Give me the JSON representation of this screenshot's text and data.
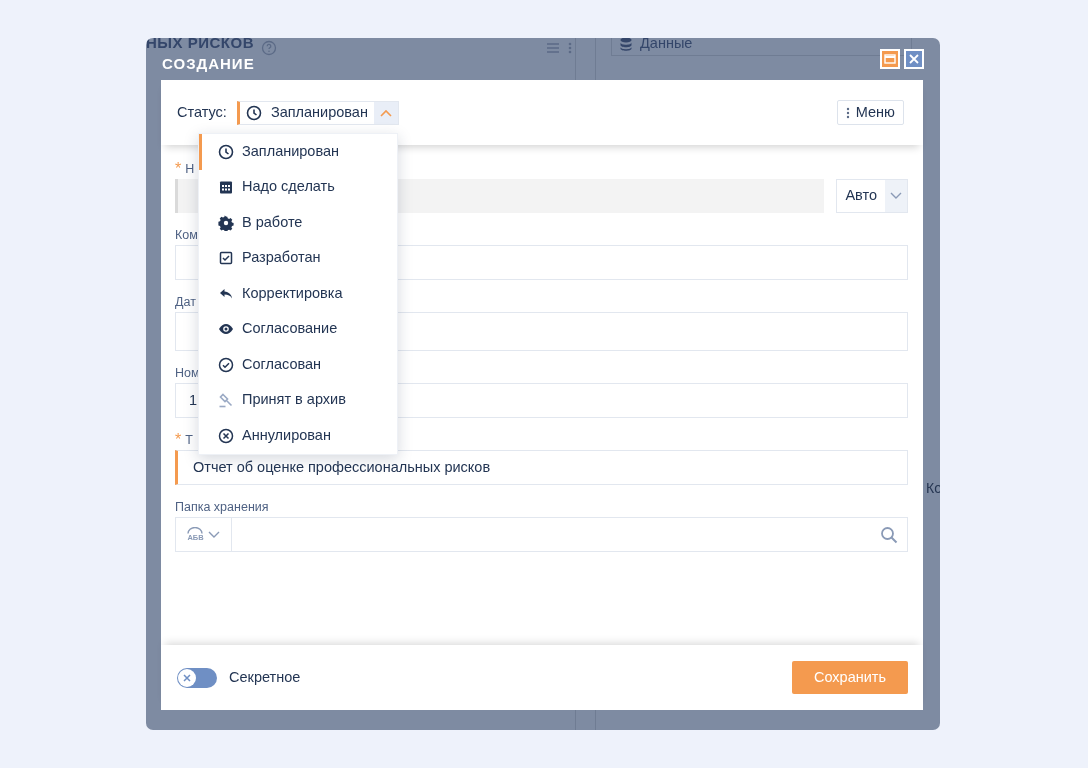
{
  "background": {
    "heading": "НЫХ РИСКОВ",
    "field_value": "Данные",
    "side_text": "Ко"
  },
  "dialog": {
    "title": "СОЗДАНИЕ"
  },
  "status": {
    "label": "Статус:",
    "value": "Запланирован",
    "expanded": true
  },
  "menu_button": "Меню",
  "status_options": [
    {
      "label": "Запланирован",
      "kind": "clock",
      "selected": true
    },
    {
      "label": "Надо сделать",
      "kind": "calendar",
      "selected": false
    },
    {
      "label": "В работе",
      "kind": "gear",
      "selected": false
    },
    {
      "label": "Разработан",
      "kind": "checkbox",
      "selected": false
    },
    {
      "label": "Корректировка",
      "kind": "reply",
      "selected": false
    },
    {
      "label": "Согласование",
      "kind": "eye",
      "selected": false
    },
    {
      "label": "Согласован",
      "kind": "check-circle",
      "selected": false
    },
    {
      "label": "Принят в архив",
      "kind": "hammer",
      "selected": false
    },
    {
      "label": "Аннулирован",
      "kind": "x-circle",
      "selected": false
    }
  ],
  "required_mark": "*",
  "fields": [
    {
      "kind": "auto",
      "label": "Н",
      "required": true,
      "select": "Авто"
    },
    {
      "kind": "text",
      "label": "Ком",
      "required": false
    },
    {
      "kind": "date",
      "label": "Дат",
      "required": false
    },
    {
      "kind": "text",
      "label": "Ном",
      "required": false,
      "value": "1"
    },
    {
      "kind": "title",
      "label": "Т",
      "required": true,
      "value": "Отчет об оценке профессиональных рисков"
    },
    {
      "kind": "folder",
      "label": "Папка хранения",
      "required": false,
      "prefix": "АБВ"
    }
  ],
  "secret_toggle": {
    "label": "Секретное",
    "on": false
  },
  "save_button": "Сохранить"
}
